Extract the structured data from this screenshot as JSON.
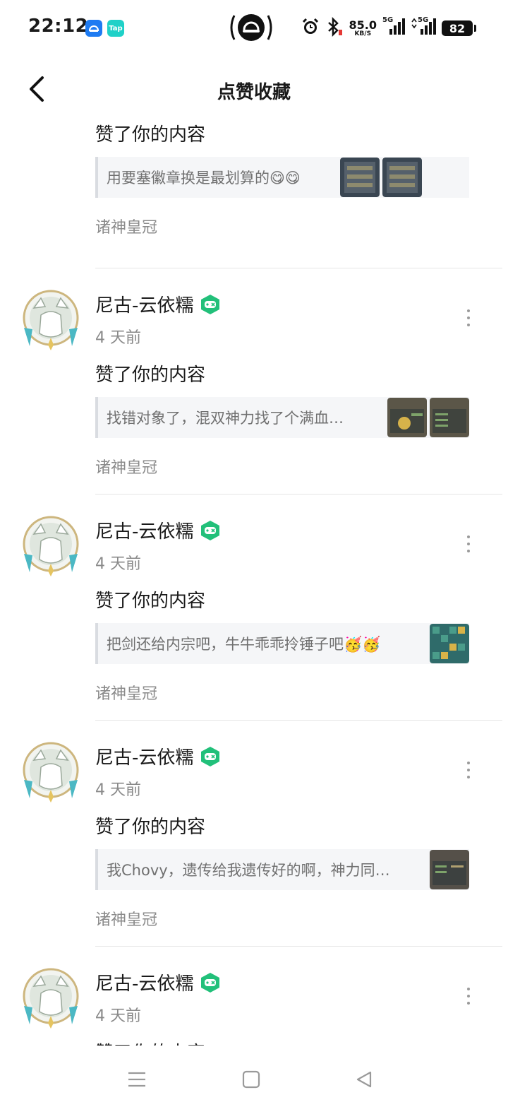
{
  "status_bar": {
    "time": "22:12",
    "app_badge_text": "Tap",
    "net_speed_value": "85.0",
    "net_speed_unit": "KB/S",
    "signal1_label": "5G",
    "signal2_label": "5G",
    "battery_level": "82"
  },
  "header": {
    "title": "点赞收藏"
  },
  "feed": {
    "items": [
      {
        "action": "赞了你的内容",
        "quote": "用要塞徽章换是最划算的😋😋",
        "source": "诸神皇冠"
      },
      {
        "name": "尼古-云依糯",
        "time": "4 天前",
        "action": "赞了你的内容",
        "quote": "找错对象了，混双神力找了个满血…",
        "source": "诸神皇冠"
      },
      {
        "name": "尼古-云依糯",
        "time": "4 天前",
        "action": "赞了你的内容",
        "quote": "把剑还给内宗吧，牛牛乖乖拎锤子吧🥳🥳",
        "source": "诸神皇冠"
      },
      {
        "name": "尼古-云依糯",
        "time": "4 天前",
        "action": "赞了你的内容",
        "quote": "我Chovy，遗传给我遗传好的啊，神力同…",
        "source": "诸神皇冠"
      },
      {
        "name": "尼古-云依糯",
        "time": "4 天前",
        "action": "赞了你的内容"
      }
    ]
  },
  "colors": {
    "accent_green": "#22c07a",
    "text_primary": "#1a1a1a",
    "text_secondary": "#8a8a8a",
    "quote_bg": "#f5f6f8"
  },
  "icons": {
    "back": "chevron-left-icon",
    "more": "more-vertical-icon",
    "badge": "gamepad-badge-icon",
    "nav_menu": "menu-icon",
    "nav_home": "square-home-icon",
    "nav_back": "triangle-back-icon"
  }
}
